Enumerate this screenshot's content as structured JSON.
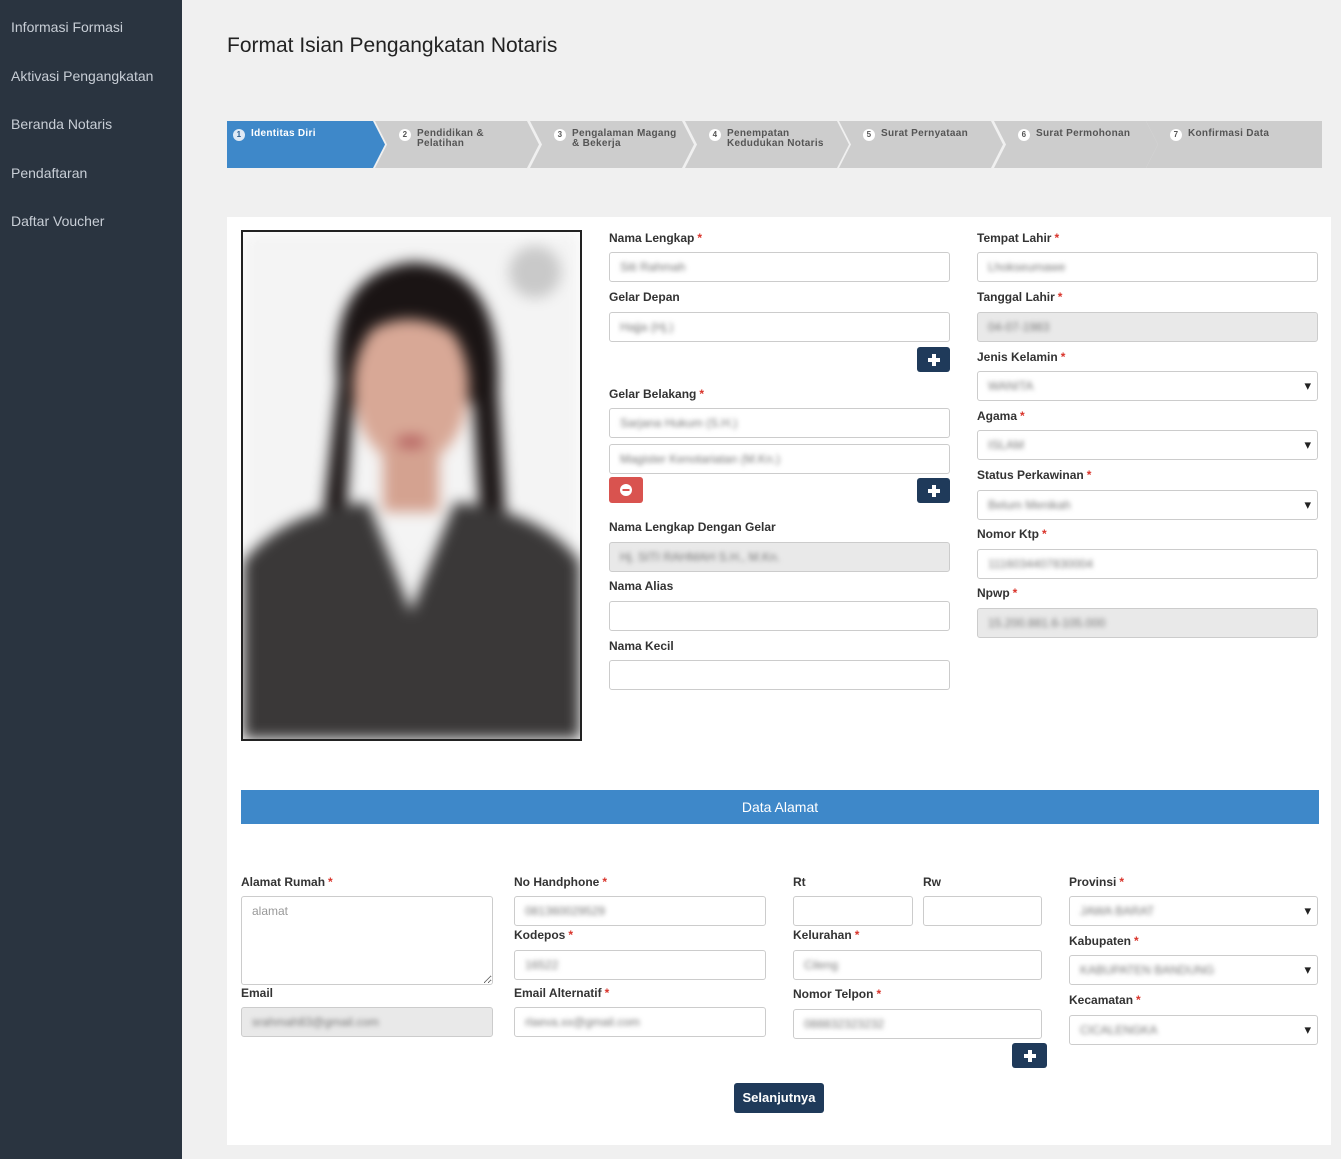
{
  "sidebar": {
    "items": [
      {
        "label": "Informasi Formasi"
      },
      {
        "label": "Aktivasi Pengangkatan"
      },
      {
        "label": "Beranda Notaris"
      },
      {
        "label": "Pendaftaran"
      },
      {
        "label": "Daftar Voucher"
      }
    ]
  },
  "page": {
    "title": "Format Isian Pengangkatan Notaris"
  },
  "stepper": {
    "active_color": "#3e88c9",
    "inactive_color": "#cdcdcd",
    "steps": [
      {
        "num": "1",
        "label": "Identitas Diri"
      },
      {
        "num": "2",
        "label": "Pendidikan &\nPelatihan"
      },
      {
        "num": "3",
        "label": "Pengalaman Magang\n& Bekerja"
      },
      {
        "num": "4",
        "label": "Penempatan\nKedudukan Notaris"
      },
      {
        "num": "5",
        "label": "Surat Pernyataan"
      },
      {
        "num": "6",
        "label": "Surat Permohonan"
      },
      {
        "num": "7",
        "label": "Konfirmasi Data"
      }
    ]
  },
  "identity": {
    "nama_lengkap": {
      "label": "Nama Lengkap",
      "value": "Siti Rahmah"
    },
    "gelar_depan": {
      "label": "Gelar Depan",
      "value": "Hajja (Hj.)"
    },
    "gelar_belakang": {
      "label": "Gelar Belakang",
      "values": [
        "Sarjana Hukum (S.H.)",
        "Magister Kenotariatan (M.Kn.)"
      ]
    },
    "nama_lengkap_gelar": {
      "label": "Nama Lengkap Dengan Gelar",
      "value": "Hj. SITI RAHMAH S.H., M.Kn."
    },
    "nama_alias": {
      "label": "Nama Alias",
      "value": ""
    },
    "nama_kecil": {
      "label": "Nama Kecil",
      "value": ""
    },
    "tempat_lahir": {
      "label": "Tempat Lahir",
      "value": "Lhokseumawe"
    },
    "tanggal_lahir": {
      "label": "Tanggal Lahir",
      "value": "04-07-1983"
    },
    "jenis_kelamin": {
      "label": "Jenis Kelamin",
      "value": "WANITA"
    },
    "agama": {
      "label": "Agama",
      "value": "ISLAM"
    },
    "status_perkawinan": {
      "label": "Status Perkawinan",
      "value": "Belum Menikah"
    },
    "nomor_ktp": {
      "label": "Nomor Ktp",
      "value": "1116034407830004"
    },
    "npwp": {
      "label": "Npwp",
      "value": "15.200.881.6-105.000"
    }
  },
  "address": {
    "section_title": "Data Alamat",
    "alamat_rumah": {
      "label": "Alamat Rumah",
      "value": "alamat"
    },
    "email": {
      "label": "Email",
      "value": "srahmah83@gmail.com"
    },
    "no_handphone": {
      "label": "No Handphone",
      "value": "081360029529"
    },
    "kodepos": {
      "label": "Kodepos",
      "value": "16522"
    },
    "email_alternatif": {
      "label": "Email Alternatif",
      "value": "rlaeva.xx@gmail.com"
    },
    "rt": {
      "label": "Rt",
      "value": ""
    },
    "rw": {
      "label": "Rw",
      "value": ""
    },
    "kelurahan": {
      "label": "Kelurahan",
      "value": "Cileng"
    },
    "nomor_telpon": {
      "label": "Nomor Telpon",
      "value": "088832323232"
    },
    "provinsi": {
      "label": "Provinsi",
      "value": "JAWA BARAT"
    },
    "kabupaten": {
      "label": "Kabupaten",
      "value": "KABUPATEN BANDUNG"
    },
    "kecamatan": {
      "label": "Kecamatan",
      "value": "CICALENGKA"
    }
  },
  "actions": {
    "next_label": "Selanjutnya"
  },
  "colors": {
    "sidebar_bg": "#2a3440",
    "primary_dark": "#1f3a5a",
    "section_blue": "#3e88c9",
    "danger": "#d9534f",
    "required": "#d9342b"
  }
}
